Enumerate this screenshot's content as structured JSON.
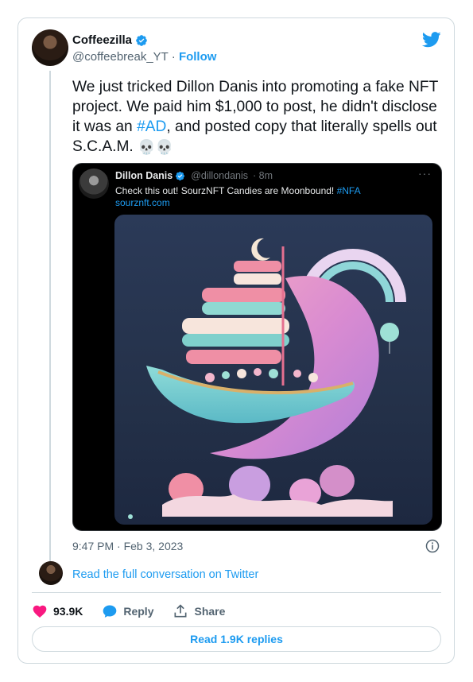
{
  "author": {
    "name": "Coffeezilla",
    "handle": "@coffeebreak_YT",
    "separator": " · ",
    "follow_label": "Follow"
  },
  "tweet": {
    "text_part1": "We just tricked Dillon Danis into promoting a fake NFT project. We paid him $1,000 to post, he didn't disclose it was an ",
    "hashtag": "#AD",
    "text_part2": ", and posted copy that literally spells out S.C.A.M. ",
    "emoji": "💀💀"
  },
  "quoted": {
    "name": "Dillon Danis",
    "handle": "@dillondanis",
    "time": "· 8m",
    "more": "···",
    "text": "Check this out! SourzNFT Candies are Moonbound! ",
    "hashtag": "#NFA",
    "link": "sourznft.com"
  },
  "timestamp": "9:47 PM · Feb 3, 2023",
  "read_conversation": "Read the full conversation on Twitter",
  "actions": {
    "likes": "93.9K",
    "reply_label": "Reply",
    "share_label": "Share"
  },
  "read_replies": "Read 1.9K replies",
  "colors": {
    "accent": "#1d9bf0",
    "like": "#f91880",
    "muted": "#536471"
  }
}
